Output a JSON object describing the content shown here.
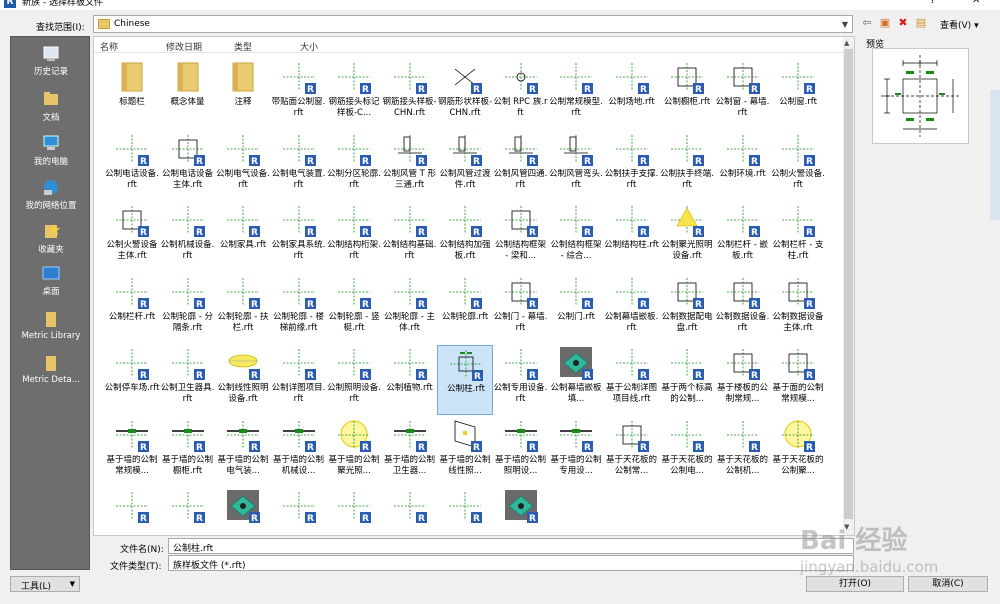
{
  "window": {
    "title": "新族 - 选择样板文件",
    "help": "?",
    "close": "✕"
  },
  "lookin": {
    "label": "查找范围(I):",
    "value": "Chinese"
  },
  "toolbar": {
    "view_label": "查看(V)"
  },
  "places": [
    {
      "label": "历史记录",
      "icon": "history-icon"
    },
    {
      "label": "文档",
      "icon": "documents-icon"
    },
    {
      "label": "我的电脑",
      "icon": "computer-icon"
    },
    {
      "label": "我的网络位置",
      "icon": "network-icon"
    },
    {
      "label": "收藏夹",
      "icon": "favorites-icon"
    },
    {
      "label": "桌面",
      "icon": "desktop-icon"
    },
    {
      "label": "Metric Library",
      "icon": "folder-icon"
    },
    {
      "label": "Metric Deta...",
      "icon": "folder-icon"
    }
  ],
  "columns": [
    "名称",
    "修改日期",
    "类型",
    "大小"
  ],
  "items": [
    {
      "label": "标题栏",
      "kind": "folder"
    },
    {
      "label": "概念体量",
      "kind": "folder"
    },
    {
      "label": "注释",
      "kind": "folder"
    },
    {
      "label": "带贴面公制窗.rft",
      "kind": "cross"
    },
    {
      "label": "钢筋接头标记样板-C...",
      "kind": "cross"
    },
    {
      "label": "钢筋接头样板-CHN.rft",
      "kind": "cross"
    },
    {
      "label": "钢筋形状样板-CHN.rft",
      "kind": "x"
    },
    {
      "label": "公制 RPC 族.rft",
      "kind": "circle"
    },
    {
      "label": "公制常规模型.rft",
      "kind": "cross"
    },
    {
      "label": "公制场地.rft",
      "kind": "cross"
    },
    {
      "label": "公制橱柜.rft",
      "kind": "box"
    },
    {
      "label": "公制窗 - 幕墙.rft",
      "kind": "box"
    },
    {
      "label": "公制窗.rft",
      "kind": "cross"
    },
    {
      "label": "公制电话设备.rft",
      "kind": "cross"
    },
    {
      "label": "公制电话设备主体.rft",
      "kind": "box"
    },
    {
      "label": "公制电气设备.rft",
      "kind": "cross"
    },
    {
      "label": "公制电气装置.rft",
      "kind": "cross"
    },
    {
      "label": "公制分区轮廓.rft",
      "kind": "cross"
    },
    {
      "label": "公制风管 T 形三通.rft",
      "kind": "pipe"
    },
    {
      "label": "公制风管过渡件.rft",
      "kind": "pipe"
    },
    {
      "label": "公制风管四通.rft",
      "kind": "pipe"
    },
    {
      "label": "公制风管弯头.rft",
      "kind": "pipe"
    },
    {
      "label": "公制扶手支撑.rft",
      "kind": "cross"
    },
    {
      "label": "公制扶手终端.rft",
      "kind": "cross"
    },
    {
      "label": "公制环境.rft",
      "kind": "cross"
    },
    {
      "label": "公制火警设备.rft",
      "kind": "cross"
    },
    {
      "label": "公制火警设备主体.rft",
      "kind": "box"
    },
    {
      "label": "公制机械设备.rft",
      "kind": "cross"
    },
    {
      "label": "公制家具.rft",
      "kind": "cross"
    },
    {
      "label": "公制家具系统.rft",
      "kind": "cross"
    },
    {
      "label": "公制结构桁架.rft",
      "kind": "cross"
    },
    {
      "label": "公制结构基础.rft",
      "kind": "cross"
    },
    {
      "label": "公制结构加强板.rft",
      "kind": "cross"
    },
    {
      "label": "公制结构框架 - 梁和...",
      "kind": "box"
    },
    {
      "label": "公制结构框架 - 综合...",
      "kind": "cross"
    },
    {
      "label": "公制结构柱.rft",
      "kind": "cross"
    },
    {
      "label": "公制聚光照明设备.rft",
      "kind": "light"
    },
    {
      "label": "公制栏杆 - 嵌板.rft",
      "kind": "cross"
    },
    {
      "label": "公制栏杆 - 支柱.rft",
      "kind": "cross"
    },
    {
      "label": "公制栏杆.rft",
      "kind": "cross"
    },
    {
      "label": "公制轮廓 - 分隔条.rft",
      "kind": "cross"
    },
    {
      "label": "公制轮廓 - 扶栏.rft",
      "kind": "cross"
    },
    {
      "label": "公制轮廓 - 楼梯前缘.rft",
      "kind": "cross"
    },
    {
      "label": "公制轮廓 - 竖梃.rft",
      "kind": "cross"
    },
    {
      "label": "公制轮廓 - 主体.rft",
      "kind": "cross"
    },
    {
      "label": "公制轮廓.rft",
      "kind": "cross"
    },
    {
      "label": "公制门 - 幕墙.rft",
      "kind": "box"
    },
    {
      "label": "公制门.rft",
      "kind": "cross"
    },
    {
      "label": "公制幕墙嵌板.rft",
      "kind": "cross"
    },
    {
      "label": "公制数据配电盘.rft",
      "kind": "box"
    },
    {
      "label": "公制数据设备.rft",
      "kind": "box"
    },
    {
      "label": "公制数据设备主体.rft",
      "kind": "box"
    },
    {
      "label": "公制停车场.rft",
      "kind": "cross"
    },
    {
      "label": "公制卫生器具.rft",
      "kind": "cross"
    },
    {
      "label": "公制线性照明设备.rft",
      "kind": "ellipse"
    },
    {
      "label": "公制详图项目.rft",
      "kind": "cross"
    },
    {
      "label": "公制照明设备.rft",
      "kind": "cross"
    },
    {
      "label": "公制植物.rft",
      "kind": "cross"
    },
    {
      "label": "公制柱.rft",
      "kind": "column",
      "selected": true
    },
    {
      "label": "公制专用设备.rft",
      "kind": "cross"
    },
    {
      "label": "公制幕墙嵌板填...",
      "kind": "photo"
    },
    {
      "label": "基于公制详图项目线.rft",
      "kind": "cross"
    },
    {
      "label": "基于两个标高的公制...",
      "kind": "cross"
    },
    {
      "label": "基于楼板的公制常规...",
      "kind": "box"
    },
    {
      "label": "基于面的公制常规模...",
      "kind": "box"
    },
    {
      "label": "基于墙的公制常规模...",
      "kind": "wall"
    },
    {
      "label": "基于墙的公制橱柜.rft",
      "kind": "wall"
    },
    {
      "label": "基于墙的公制电气装...",
      "kind": "wall"
    },
    {
      "label": "基于墙的公制机械设...",
      "kind": "wall"
    },
    {
      "label": "基于墙的公制聚光照...",
      "kind": "yellowcircle"
    },
    {
      "label": "基于墙的公制卫生器...",
      "kind": "wall"
    },
    {
      "label": "基于墙的公制线性照...",
      "kind": "panel"
    },
    {
      "label": "基于墙的公制照明设...",
      "kind": "wall"
    },
    {
      "label": "基于墙的公制专用设...",
      "kind": "wall"
    },
    {
      "label": "基于天花板的公制常...",
      "kind": "box"
    },
    {
      "label": "基于天花板的公制电...",
      "kind": "cross"
    },
    {
      "label": "基于天花板的公制机...",
      "kind": "cross"
    },
    {
      "label": "基于天花板的公制聚...",
      "kind": "yellowcircle"
    },
    {
      "label": "",
      "kind": "cross"
    },
    {
      "label": "",
      "kind": "cross"
    },
    {
      "label": "",
      "kind": "photo"
    },
    {
      "label": "",
      "kind": "cross"
    },
    {
      "label": "",
      "kind": "cross"
    },
    {
      "label": "",
      "kind": "cross"
    },
    {
      "label": "",
      "kind": "cross"
    },
    {
      "label": "",
      "kind": "photo"
    }
  ],
  "preview": {
    "label": "预览"
  },
  "filename": {
    "label": "文件名(N):",
    "value": "公制柱.rft"
  },
  "filetype": {
    "label": "文件类型(T):",
    "value": "族样板文件 (*.rft)"
  },
  "buttons": {
    "tools": "工具(L)",
    "open": "打开(O)",
    "cancel": "取消(C)"
  },
  "watermark": {
    "line1": "Bai 经验",
    "line2": "jingyan.baidu.com"
  }
}
